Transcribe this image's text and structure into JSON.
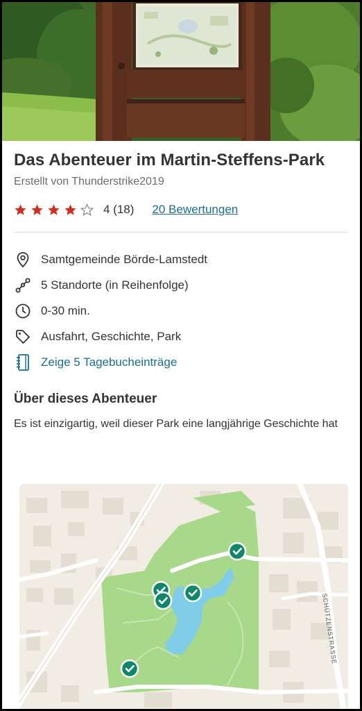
{
  "adventure": {
    "title": "Das Abenteuer im Martin-Steffens-Park",
    "creator": "Erstellt von Thunderstrike2019",
    "rating": {
      "stars_filled": 4,
      "stars_total": 5,
      "summary": "4 (18)",
      "reviews_link": "20 Bewertungen"
    },
    "details": {
      "location": "Samtgemeinde Börde-Lamstedt",
      "stops": "5 Standorte (in Reihenfolge)",
      "duration": "0-30 min.",
      "tags": "Ausfahrt, Geschichte, Park",
      "journal_link": "Zeige 5 Tagebucheinträge"
    },
    "about": {
      "heading": "Über dieses Abenteuer",
      "text": "Es ist einzigartig, weil dieser Park eine langjährige Geschichte hat"
    },
    "map": {
      "street_label": "SCHÜTZENSTRASSE"
    }
  },
  "icons": {
    "location": "map-pin-icon",
    "stops": "route-icon",
    "duration": "clock-icon",
    "tags": "tag-icon",
    "journal": "journal-icon",
    "marker": "check-marker-icon"
  },
  "colors": {
    "star": "#d32b1e",
    "link": "#1a6f8c",
    "marker": "#11876a",
    "park": "#a8d98a",
    "water": "#7fcde8"
  }
}
